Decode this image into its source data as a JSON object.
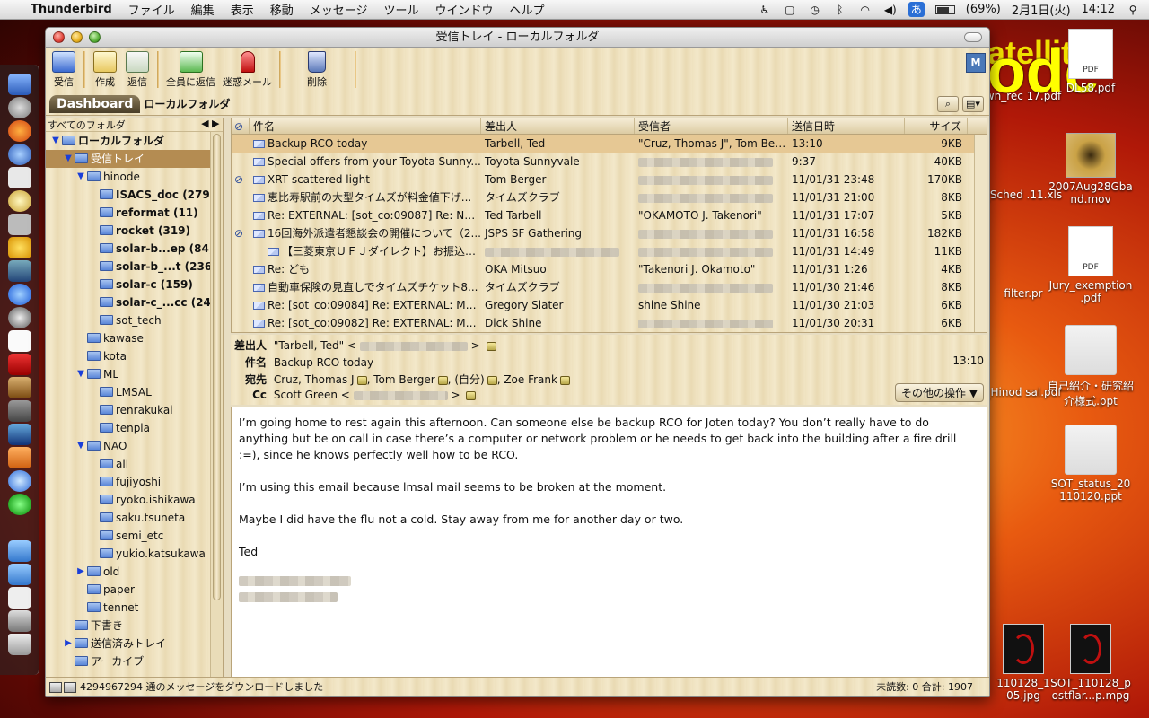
{
  "menubar": {
    "app": "Thunderbird",
    "menus": [
      "ファイル",
      "編集",
      "表示",
      "移動",
      "メッセージ",
      "ツール",
      "ウインドウ",
      "ヘルプ"
    ],
    "input_method": "あ",
    "battery": "(69%)",
    "date": "2月1日(火)",
    "time": "14:12"
  },
  "window": {
    "title": "受信トレイ - ローカルフォルダ"
  },
  "toolbar": {
    "buttons": [
      {
        "label": "受信",
        "icon": "get-mail-icon"
      },
      {
        "label": "作成",
        "icon": "compose-icon"
      },
      {
        "label": "返信",
        "icon": "reply-icon"
      },
      {
        "label": "全員に返信",
        "icon": "reply-all-icon"
      },
      {
        "label": "迷惑メール",
        "icon": "junk-icon"
      },
      {
        "label": "削除",
        "icon": "trash-icon"
      }
    ]
  },
  "tabs": {
    "dashboard": "Dashboard",
    "current": "ローカルフォルダ"
  },
  "folders": {
    "header": "すべてのフォルダ",
    "items": [
      {
        "label": "ローカルフォルダ",
        "depth": 0,
        "twisty": "▼",
        "bold": true
      },
      {
        "label": "受信トレイ",
        "depth": 1,
        "twisty": "▼",
        "selected": true
      },
      {
        "label": "hinode",
        "depth": 2,
        "twisty": "▼"
      },
      {
        "label": "ISACS_doc (279)",
        "depth": 3,
        "bold": true
      },
      {
        "label": "reformat (11)",
        "depth": 3,
        "bold": true
      },
      {
        "label": "rocket (319)",
        "depth": 3,
        "bold": true
      },
      {
        "label": "solar-b...ep (84)",
        "depth": 3,
        "bold": true
      },
      {
        "label": "solar-b_...t (236)",
        "depth": 3,
        "bold": true
      },
      {
        "label": "solar-c (159)",
        "depth": 3,
        "bold": true
      },
      {
        "label": "solar-c_...cc (24)",
        "depth": 3,
        "bold": true
      },
      {
        "label": "sot_tech",
        "depth": 3
      },
      {
        "label": "kawase",
        "depth": 2
      },
      {
        "label": "kota",
        "depth": 2
      },
      {
        "label": "ML",
        "depth": 2,
        "twisty": "▼"
      },
      {
        "label": "LMSAL",
        "depth": 3
      },
      {
        "label": "renrakukai",
        "depth": 3
      },
      {
        "label": "tenpla",
        "depth": 3
      },
      {
        "label": "NAO",
        "depth": 2,
        "twisty": "▼"
      },
      {
        "label": "all",
        "depth": 3
      },
      {
        "label": "fujiyoshi",
        "depth": 3
      },
      {
        "label": "ryoko.ishikawa",
        "depth": 3
      },
      {
        "label": "saku.tsuneta",
        "depth": 3
      },
      {
        "label": "semi_etc",
        "depth": 3
      },
      {
        "label": "yukio.katsukawa",
        "depth": 3
      },
      {
        "label": "old",
        "depth": 2,
        "twisty": "▶"
      },
      {
        "label": "paper",
        "depth": 2
      },
      {
        "label": "tennet",
        "depth": 2
      },
      {
        "label": "下書き",
        "depth": 1
      },
      {
        "label": "送信済みトレイ",
        "depth": 1,
        "twisty": "▶"
      },
      {
        "label": "アーカイブ",
        "depth": 1
      }
    ]
  },
  "msglist": {
    "columns": {
      "subject": "件名",
      "from": "差出人",
      "to": "受信者",
      "date": "送信日時",
      "size": "サイズ"
    },
    "rows": [
      {
        "subject": "Backup RCO today",
        "from": "Tarbell, Ted",
        "to": "\"Cruz, Thomas J\", Tom Ber...",
        "date": "13:10",
        "size": "9KB",
        "selected": true
      },
      {
        "subject": "Special offers from your Toyota Sunny...",
        "from": "Toyota Sunnyvale",
        "to": "",
        "date": "9:37",
        "size": "40KB"
      },
      {
        "subject": "XRT scattered light",
        "from": "Tom Berger",
        "to": "",
        "date": "11/01/31 23:48",
        "size": "170KB",
        "attach": true
      },
      {
        "subject": "恵比寿駅前の大型タイムズが料金値下げ...",
        "from": "タイムズクラブ",
        "to": "",
        "date": "11/01/31 21:00",
        "size": "8KB"
      },
      {
        "subject": "Re: EXTERNAL: [sot_co:09087] Re: Noti...",
        "from": "Ted Tarbell",
        "to": "\"OKAMOTO J. Takenori\"",
        "date": "11/01/31 17:07",
        "size": "5KB"
      },
      {
        "subject": "16回海外派遣者懇談会の開催について（2...",
        "from": "JSPS SF Gathering",
        "to": "",
        "date": "11/01/31 16:58",
        "size": "182KB",
        "attach": true
      },
      {
        "subject": "【三菱東京ＵＦＪダイレクト】お振込受...",
        "from": "",
        "to": "",
        "date": "11/01/31 14:49",
        "size": "11KB",
        "indent": true
      },
      {
        "subject": "Re: ども",
        "from": "OKA Mitsuo",
        "to": "\"Takenori J. Okamoto\"",
        "date": "11/01/31 1:26",
        "size": "4KB",
        "replied": true
      },
      {
        "subject": "自動車保険の見直しでタイムズチケット8...",
        "from": "タイムズクラブ",
        "to": "",
        "date": "11/01/30 21:46",
        "size": "8KB"
      },
      {
        "subject": "Re: [sot_co:09084] Re: EXTERNAL:  Mo...",
        "from": "Gregory Slater",
        "to": "shine Shine",
        "date": "11/01/30 21:03",
        "size": "6KB"
      },
      {
        "subject": "Re: [sot_co:09082] Re: EXTERNAL:  Mo...",
        "from": "Dick Shine",
        "to": "",
        "date": "11/01/30 20:31",
        "size": "6KB"
      }
    ]
  },
  "header": {
    "from_label": "差出人",
    "from_value": "\"Tarbell, Ted\" <",
    "subject_label": "件名",
    "subject_value": "Backup RCO today",
    "time": "13:10",
    "to_label": "宛先",
    "to_recipients": [
      "Cruz, Thomas J",
      "Tom Berger",
      "(自分)",
      "Zoe Frank"
    ],
    "cc_label": "Cc",
    "cc_value": "Scott Green <",
    "more_button": "その他の操作 ▼"
  },
  "body": {
    "paragraphs": [
      "I’m going home to rest again this afternoon.  Can someone else be backup RCO for Joten today?  You don’t really have to do anything but be on call in case there’s a computer or network problem or he needs to get back into the building after a fire drill :=), since he knows perfectly well how to be RCO.",
      "I’m using this email because lmsal mail seems to be broken at the moment.",
      "Maybe I did have the flu not a cold.  Stay away from me for  another day or two.",
      "Ted"
    ]
  },
  "status": {
    "text": "4294967294 通のメッセージをダウンロードしました",
    "counts": "未読数: 0  合計: 1907"
  },
  "desktop": {
    "items": [
      {
        "label": "DL58.pdf"
      },
      {
        "label": "wn_rec 17.pdf"
      },
      {
        "label": "2007Aug28Gba nd.mov"
      },
      {
        "label": "_Sched .11.xls"
      },
      {
        "label": "Jury_exemption .pdf"
      },
      {
        "label": "filter.pr"
      },
      {
        "label": "自己紹介・研究紹 介様式.ppt"
      },
      {
        "label": "_Hinod sal.pdf"
      },
      {
        "label": "SOT_status_20 110120.ppt"
      },
      {
        "label": "SOT_110128_p ostflar...p.mpg"
      },
      {
        "label": "110128_1 05.jpg"
      }
    ],
    "logo_text": "atellite",
    "big_text": "ode"
  },
  "colors": {
    "accent_selected_folder": "#b48c52",
    "selected_row": "#e6c894",
    "wood": "#efe2bf"
  }
}
